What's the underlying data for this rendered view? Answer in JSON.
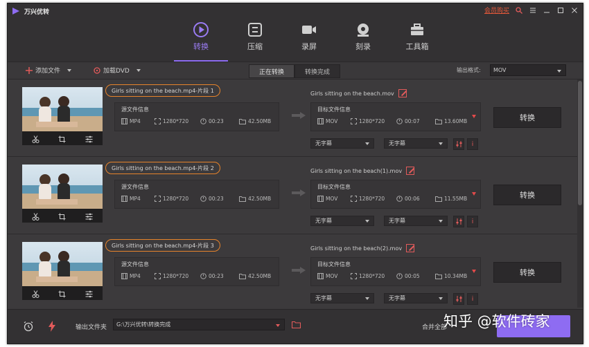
{
  "app": {
    "name": "万兴优转",
    "vip_link": "会员购买"
  },
  "nav": [
    {
      "label": "转换",
      "icon": "convert-icon",
      "active": true
    },
    {
      "label": "压缩",
      "icon": "compress-icon",
      "active": false
    },
    {
      "label": "录屏",
      "icon": "record-screen-icon",
      "active": false
    },
    {
      "label": "刻录",
      "icon": "burn-icon",
      "active": false
    },
    {
      "label": "工具箱",
      "icon": "toolbox-icon",
      "active": false
    }
  ],
  "toolbar": {
    "add_file": "添加文件",
    "load_dvd": "加载DVD",
    "tab_converting": "正在转换",
    "tab_done": "转换完成",
    "output_format_label": "输出格式:",
    "output_format_value": "MOV"
  },
  "items": [
    {
      "src_name": "Girls sitting on the beach.mp4-片段 1",
      "src_info_title": "源文件信息",
      "src": {
        "format": "MP4",
        "resolution": "1280*720",
        "duration": "00:23",
        "size": "42.50MB"
      },
      "dst_name": "Girls sitting on the beach.mov",
      "dst_info_title": "目标文件信息",
      "dst": {
        "format": "MOV",
        "resolution": "1280*720",
        "duration": "00:07",
        "size": "13.60MB"
      },
      "subtitle": "无字幕",
      "audio": "无字幕",
      "convert": "转换"
    },
    {
      "src_name": "Girls sitting on the beach.mp4-片段 2",
      "src_info_title": "源文件信息",
      "src": {
        "format": "MP4",
        "resolution": "1280*720",
        "duration": "00:23",
        "size": "42.50MB"
      },
      "dst_name": "Girls sitting on the beach(1).mov",
      "dst_info_title": "目标文件信息",
      "dst": {
        "format": "MOV",
        "resolution": "1280*720",
        "duration": "00:06",
        "size": "11.55MB"
      },
      "subtitle": "无字幕",
      "audio": "无字幕",
      "convert": "转换"
    },
    {
      "src_name": "Girls sitting on the beach.mp4-片段 3",
      "src_info_title": "源文件信息",
      "src": {
        "format": "MP4",
        "resolution": "1280*720",
        "duration": "00:23",
        "size": "42.50MB"
      },
      "dst_name": "Girls sitting on the beach(2).mov",
      "dst_info_title": "目标文件信息",
      "dst": {
        "format": "MOV",
        "resolution": "1280*720",
        "duration": "00:05",
        "size": "10.34MB"
      },
      "subtitle": "无字幕",
      "audio": "无字幕",
      "convert": "转换"
    }
  ],
  "footer": {
    "output_folder_label": "输出文件夹",
    "output_path": "G:\\万兴优转\\转换完成",
    "merge_label": "合并全部"
  },
  "watermark": "知乎 @软件砖家",
  "colors": {
    "accent": "#8e6cf2",
    "highlight": "#e8842b",
    "warn": "#e35b5b"
  }
}
